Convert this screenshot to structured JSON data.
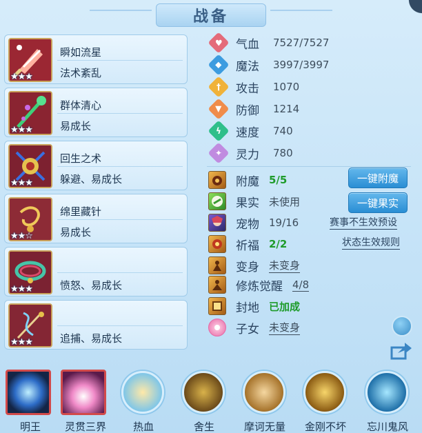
{
  "title": "战备",
  "skills": [
    {
      "name": "瞬如流星",
      "desc": "法术紊乱",
      "stars": "★★★",
      "icon": "popsicle-icon",
      "color": "#9b2733"
    },
    {
      "name": "群体清心",
      "desc": "易成长",
      "stars": "★★★",
      "icon": "staff-icon",
      "color": "#8a2431"
    },
    {
      "name": "回生之术",
      "desc": "躲避、易成长",
      "stars": "★★★",
      "icon": "scroll-icon",
      "color": "#7d2130"
    },
    {
      "name": "绵里藏针",
      "desc": "易成长",
      "stars": "★★☆",
      "icon": "bracelet-icon",
      "color": "#8d2b36"
    },
    {
      "name": "",
      "desc": "愤怒、易成长",
      "stars": "★★★",
      "icon": "ring-icon",
      "color": "#7b2232"
    },
    {
      "name": "",
      "desc": "追捕、易成长",
      "stars": "★★★",
      "icon": "whip-icon",
      "color": "#842634"
    }
  ],
  "stats": [
    {
      "label": "气血",
      "value": "7527/7527",
      "color": "#e46b7a",
      "icon": "heart-icon"
    },
    {
      "label": "魔法",
      "value": "3997/3997",
      "color": "#3d9ce0",
      "icon": "mana-icon"
    },
    {
      "label": "攻击",
      "value": "1070",
      "color": "#f0b23a",
      "icon": "sword-icon"
    },
    {
      "label": "防御",
      "value": "1214",
      "color": "#f08c4a",
      "icon": "shield-icon"
    },
    {
      "label": "速度",
      "value": "740",
      "color": "#2fbf8a",
      "icon": "lightning-icon"
    },
    {
      "label": "灵力",
      "value": "780",
      "color": "#c08be0",
      "icon": "spirit-icon"
    }
  ],
  "info": [
    {
      "label": "附魔",
      "value": "5/5",
      "style": "green",
      "icon": "enchant-icon"
    },
    {
      "label": "果实",
      "value": "未使用",
      "style": "plain",
      "icon": "fruit-icon"
    },
    {
      "label": "宠物",
      "value": "19/16",
      "style": "plain",
      "icon": "pet-avatar-icon"
    },
    {
      "label": "祈福",
      "value": "2/2",
      "style": "green",
      "icon": "blessing-icon"
    },
    {
      "label": "变身",
      "value": "未变身",
      "style": "link",
      "icon": "transform-icon"
    },
    {
      "label": "修炼觉醒",
      "value": "4/8",
      "style": "link",
      "icon": "cultivation-icon"
    },
    {
      "label": "封地",
      "value": "已加成",
      "style": "green",
      "icon": "fief-icon"
    },
    {
      "label": "子女",
      "value": "未变身",
      "style": "link",
      "icon": "children-icon"
    }
  ],
  "buttons": {
    "enchant": "一键附魔",
    "fruit": "一键果实"
  },
  "links": {
    "event_preset": "赛事不生效预设",
    "status_rules": "状态生效规则"
  },
  "bottom": [
    {
      "label": "明王",
      "shape": "square",
      "icon": "mingwang-icon"
    },
    {
      "label": "灵贯三界",
      "shape": "square",
      "icon": "lingguan-icon"
    },
    {
      "label": "热血",
      "shape": "circle",
      "icon": "rexue-icon"
    },
    {
      "label": "舍生",
      "shape": "circle",
      "icon": "shesheng-icon"
    },
    {
      "label": "摩诃无量",
      "shape": "circle",
      "icon": "mohe-icon"
    },
    {
      "label": "金刚不坏",
      "shape": "circle",
      "icon": "jingang-icon"
    },
    {
      "label": "忘川鬼风",
      "shape": "circle",
      "icon": "wangchuan-icon"
    }
  ]
}
